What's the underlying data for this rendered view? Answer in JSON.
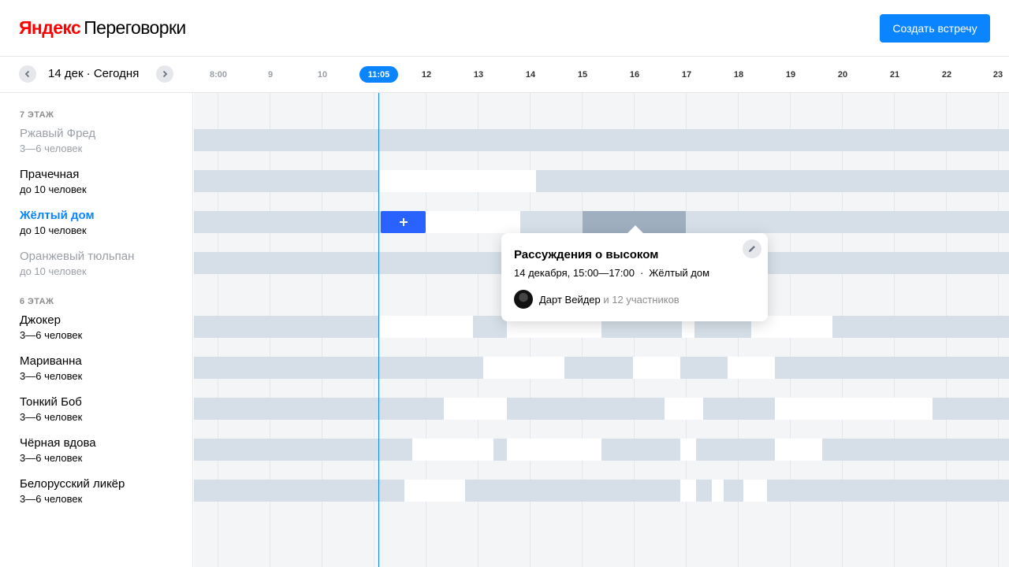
{
  "header": {
    "logo_brand": "Яндекс",
    "logo_product": "Переговорки",
    "create_button": "Создать встречу"
  },
  "timeline": {
    "date_label": "14 дек · Сегодня",
    "now_label": "11:05",
    "hours": [
      "8:00",
      "9",
      "10",
      "12",
      "13",
      "14",
      "15",
      "16",
      "17",
      "18",
      "19",
      "20",
      "21",
      "22",
      "23"
    ]
  },
  "floors": [
    {
      "label": "7 ЭТАЖ",
      "rooms": [
        {
          "name": "Ржавый Фред",
          "capacity": "3—6 человек",
          "state": "disabled"
        },
        {
          "name": "Прачечная",
          "capacity": "до 10 человек",
          "state": "normal"
        },
        {
          "name": "Жёлтый дом",
          "capacity": "до 10 человек",
          "state": "active"
        },
        {
          "name": "Оранжевый тюльпан",
          "capacity": "до 10 человек",
          "state": "disabled"
        }
      ]
    },
    {
      "label": "6 ЭТАЖ",
      "rooms": [
        {
          "name": "Джокер",
          "capacity": "3—6 человек",
          "state": "normal"
        },
        {
          "name": "Мариванна",
          "capacity": "3—6 человек",
          "state": "normal"
        },
        {
          "name": "Тонкий Боб",
          "capacity": "3—6 человек",
          "state": "normal"
        },
        {
          "name": "Чёрная вдова",
          "capacity": "3—6 человек",
          "state": "normal"
        },
        {
          "name": "Белорусский ликёр",
          "capacity": "3—6 человек",
          "state": "normal"
        }
      ]
    }
  ],
  "add_button_icon": "plus-icon",
  "popup": {
    "title": "Рассуждения о высоком",
    "date_time": "14 декабря, 15:00—17:00",
    "separator": "·",
    "room": "Жёлтый дом",
    "organizer": "Дарт Вейдер",
    "participants": "и 12 участников"
  },
  "colors": {
    "accent": "#0a84ff",
    "brand_red": "#ff0000",
    "busy": "#d6dfe8",
    "free": "#ffffff",
    "selected": "#9fafc0",
    "grid_bg": "#f4f5f7"
  }
}
